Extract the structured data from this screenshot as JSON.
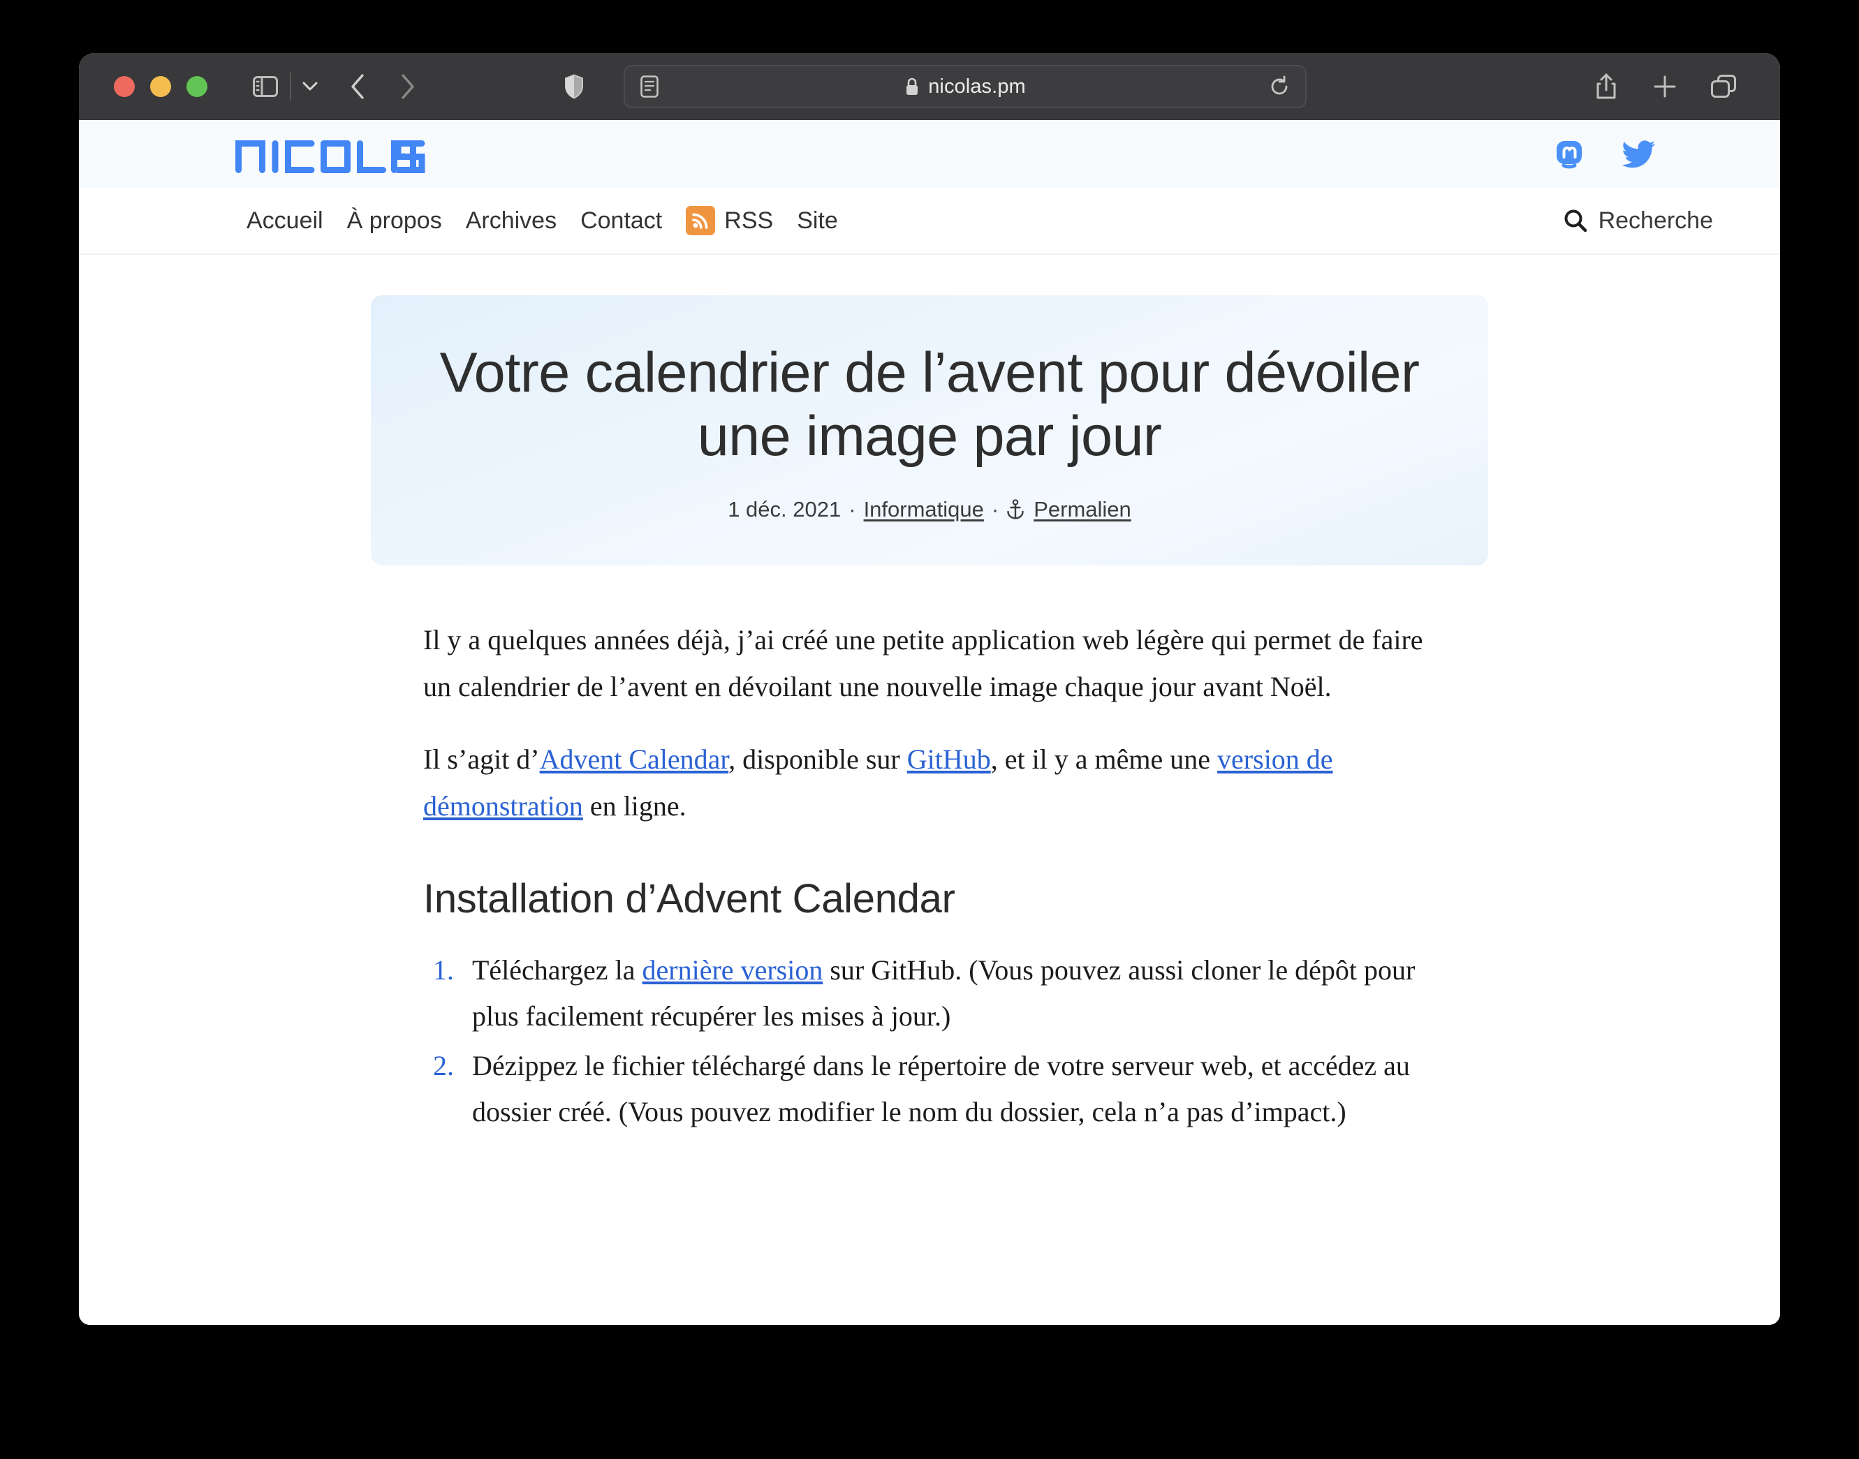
{
  "browser": {
    "traffic_lights": [
      "close",
      "minimize",
      "maximize"
    ],
    "url": "nicolas.pm",
    "icons": {
      "sidebar": "sidebar-icon",
      "tab_overview_chevron": "chevron-down-icon",
      "back": "back-arrow-icon",
      "forward": "forward-arrow-icon",
      "shield": "privacy-shield-icon",
      "reader": "reader-view-icon",
      "lock": "lock-icon",
      "reload": "reload-icon",
      "share": "share-icon",
      "new_tab": "plus-icon",
      "tabs": "tab-overview-icon"
    }
  },
  "site": {
    "logo_text": "NICOLAS",
    "accent_color": "#4285f4",
    "rss_color": "#ef9540",
    "link_color": "#2a62d4",
    "socials": [
      {
        "name": "mastodon",
        "label": "Mastodon"
      },
      {
        "name": "twitter",
        "label": "Twitter"
      }
    ],
    "nav": [
      {
        "label": "Accueil",
        "icon": null
      },
      {
        "label": "À propos",
        "icon": null
      },
      {
        "label": "Archives",
        "icon": null
      },
      {
        "label": "Contact",
        "icon": null
      },
      {
        "label": "RSS",
        "icon": "rss-icon"
      },
      {
        "label": "Site",
        "icon": null
      }
    ],
    "search": {
      "label": "Recherche",
      "icon": "search-icon"
    }
  },
  "hero": {
    "title": "Votre calendrier de l’avent pour dévoiler une image par jour",
    "date": "1 déc. 2021",
    "sep1": "·",
    "category": "Informatique",
    "sep2": "·",
    "permalink": "Permalien",
    "permalink_icon": "anchor-icon"
  },
  "article": {
    "paragraph1": "Il y a quelques années déjà, j’ai créé une petite application web légère qui permet de faire un calendrier de l’avent en dévoilant une nouvelle image chaque jour avant Noël.",
    "paragraph2": {
      "pre": "Il s’agit d’",
      "link1": "Advent Calendar",
      "mid1": ", disponible sur ",
      "link2": "GitHub",
      "mid2": ", et il y a même une ",
      "link3": "version de démonstration",
      "post": " en ligne."
    },
    "heading": "Installation d’Advent Calendar",
    "list": [
      {
        "pre": "Téléchargez la ",
        "link": "dernière version",
        "post": " sur GitHub. (Vous pouvez aussi cloner le dépôt pour plus facilement récupérer les mises à jour.)"
      },
      {
        "pre": "Dézippez le fichier téléchargé dans le répertoire de votre serveur web, et accédez au dossier créé. (Vous pouvez modifier le nom du dossier, cela n’a pas d’impact.)",
        "link": "",
        "post": ""
      }
    ]
  }
}
